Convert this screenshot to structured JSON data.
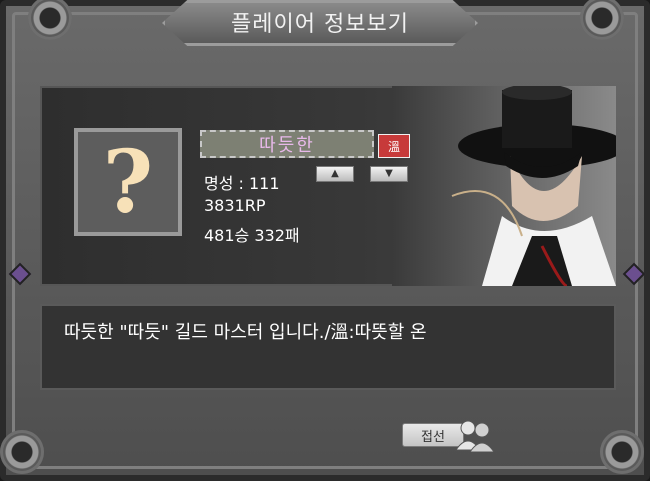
{
  "window": {
    "title": "플레이어 정보보기"
  },
  "player": {
    "name": "따듯한",
    "guild_badge": "溫",
    "stats": {
      "reputation_line": "명성 : 111",
      "rp_line": "3831RP",
      "record_line": "481승 332패"
    }
  },
  "description": {
    "text": "따듯한 \"따듯\" 길드 마스터 입니다./溫:따뜻할 온"
  },
  "actions": {
    "close_label": "접선"
  },
  "icons": {
    "portrait": "question-mark-icon",
    "arrow_up": "triangle-up-icon",
    "arrow_down": "triangle-down-icon",
    "friends": "friends-icon",
    "gear": "gear-icon"
  },
  "colors": {
    "name_text": "#e8b9ea",
    "guild_badge_bg": "#c73a3a",
    "portrait_qmark": "#f7e1b8"
  }
}
